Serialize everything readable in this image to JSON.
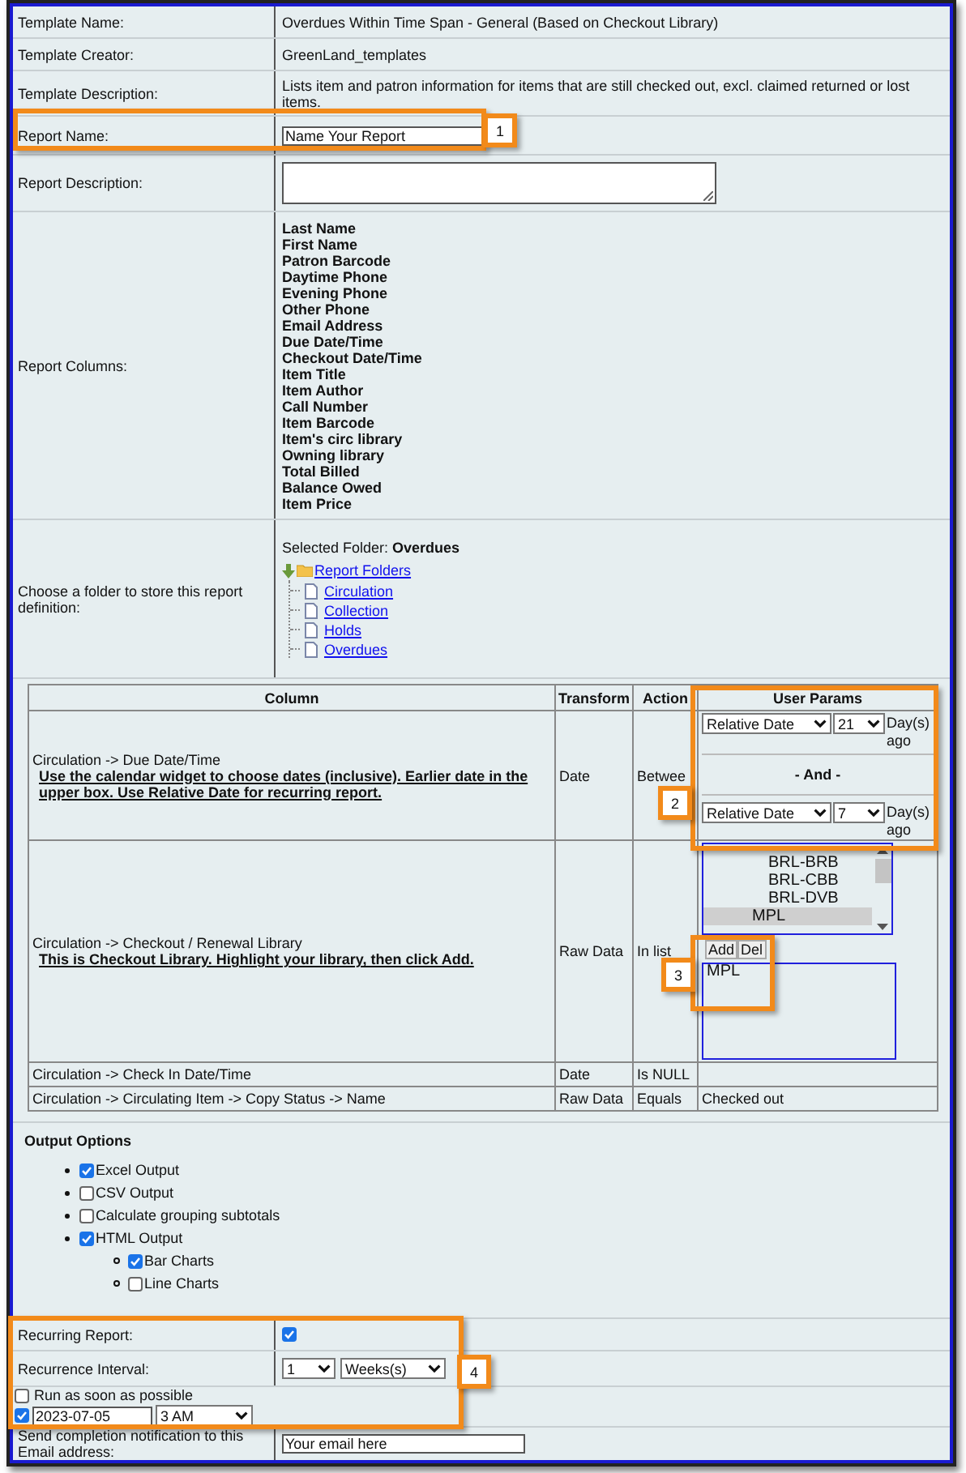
{
  "info_rows": [
    {
      "kind": "text",
      "label": "Template Name:",
      "value": "Overdues Within Time Span - General (Based on Checkout Library)"
    },
    {
      "kind": "text",
      "label": "Template Creator:",
      "value": "GreenLand_templates"
    },
    {
      "kind": "text",
      "label": "Template Description:",
      "value": "Lists item and patron information for items that are still checked out, excl. claimed returned or lost items."
    },
    {
      "kind": "input",
      "label": "Report Name:",
      "value": "Name Your Report"
    },
    {
      "kind": "textarea",
      "label": "Report Description:"
    },
    {
      "kind": "list",
      "label": "Report Columns:",
      "items": [
        "Last Name",
        "First Name",
        "Patron Barcode",
        "Daytime Phone",
        "Evening Phone",
        "Other Phone",
        "Email Address",
        "Due Date/Time",
        "Checkout Date/Time",
        "Item Title",
        "Item Author",
        "Call Number",
        "Item Barcode",
        "Item's circ library",
        "Owning library",
        "Total Billed",
        "Balance Owed",
        "Item Price"
      ]
    },
    {
      "kind": "folders",
      "label": "Choose a folder to store this report definition:",
      "selected_label": "Selected Folder:",
      "selected_folder": "Overdues",
      "root": "Report Folders",
      "children": [
        {
          "label": "Circulation"
        },
        {
          "label": "Collection"
        },
        {
          "label": "Holds"
        },
        {
          "label": "Overdues"
        }
      ]
    }
  ],
  "params_table": {
    "columns": [
      "Column",
      "Transform",
      "Action",
      "User Params"
    ],
    "rows": [
      {
        "kind": "between",
        "column": "Circulation -> Due Date/Time",
        "hint": "Use the calendar widget to choose dates (inclusive). Earlier date in the upper box. Use Relative Date for recurring report.",
        "transform": "Date",
        "action": "Betwee",
        "from": {
          "type": "Relative Date",
          "amount": "21",
          "unit": "Day(s) ago"
        },
        "separator": "- And -",
        "to": {
          "type": "Relative Date",
          "amount": "7",
          "unit": "Day(s) ago"
        }
      },
      {
        "kind": "in_list",
        "column": "Circulation -> Checkout / Renewal Library",
        "hint": "This is Checkout Library. Highlight your library, then click Add.",
        "transform": "Raw Data",
        "action": "In list",
        "options": [
          {
            "label": "BRL-BRB",
            "selected": false
          },
          {
            "label": "BRL-CBB",
            "selected": false
          },
          {
            "label": "BRL-DVB",
            "selected": false
          },
          {
            "label": "MPL",
            "selected": true
          }
        ],
        "add": "Add",
        "del": "Del",
        "chosen": [
          "MPL"
        ]
      },
      {
        "kind": "plain",
        "column": "Circulation -> Check In Date/Time",
        "transform": "Date",
        "action": "Is NULL"
      },
      {
        "kind": "plain",
        "column": "Circulation -> Circulating Item -> Copy Status -> Name",
        "transform": "Raw Data",
        "action": "Equals",
        "value": "Checked out"
      }
    ]
  },
  "output_options": {
    "title": "Output Options",
    "items": [
      {
        "label": "Excel Output",
        "checked": true
      },
      {
        "label": "CSV Output",
        "checked": false
      },
      {
        "label": "Calculate grouping subtotals",
        "checked": false
      },
      {
        "label": "HTML Output",
        "checked": true,
        "children": [
          {
            "label": "Bar Charts",
            "checked": true
          },
          {
            "label": "Line Charts",
            "checked": false
          }
        ]
      }
    ]
  },
  "recurring": {
    "label": "Recurring Report:",
    "checked": true
  },
  "interval": {
    "label": "Recurrence Interval:",
    "amount": "1",
    "unit": "Weeks(s)"
  },
  "run_asap": {
    "label": "Run as soon as possible",
    "checked": false
  },
  "scheduled": {
    "checked": true,
    "date": "2023-07-05",
    "time": "3 AM"
  },
  "email": {
    "label": "Send completion notification to this Email address:",
    "placeholder": "Your email here"
  },
  "callouts": [
    {
      "label": "1"
    },
    {
      "label": "2"
    },
    {
      "label": "3"
    },
    {
      "label": "4"
    }
  ]
}
